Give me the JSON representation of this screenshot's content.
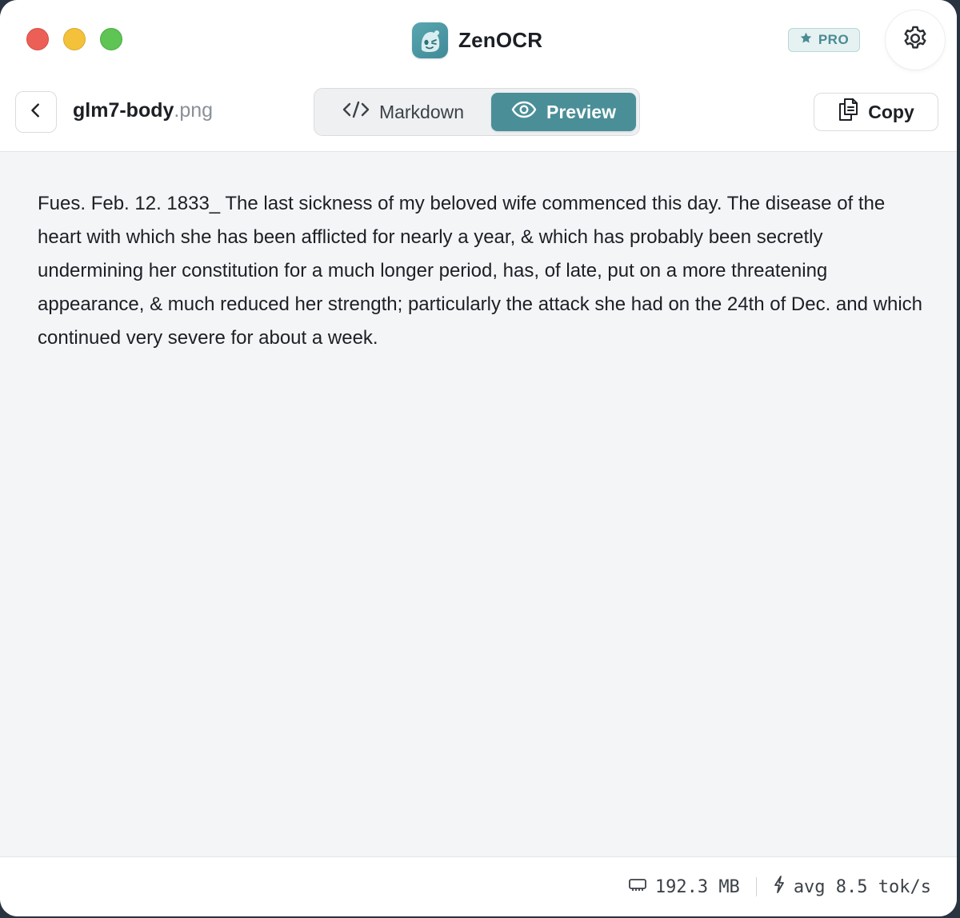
{
  "app": {
    "name": "ZenOCR",
    "badge": "PRO",
    "accent": "#4a8f98"
  },
  "toolbar": {
    "file_base": "glm7-body",
    "file_ext": ".png",
    "tabs": [
      {
        "label": "Markdown",
        "icon": "code-icon",
        "active": false
      },
      {
        "label": "Preview",
        "icon": "eye-icon",
        "active": true
      }
    ],
    "copy_label": "Copy"
  },
  "content": {
    "text": "Fues. Feb. 12. 1833_ The last sickness of my beloved wife commenced this day. The disease of the heart with which she has been afflicted for nearly a year, & which has probably been secretly undermining her constitution for a much longer period, has, of late, put on a more threatening appearance, & much reduced her strength; particularly the attack she had on the 24th of Dec. and which continued very severe for about a week."
  },
  "footer": {
    "memory": "192.3 MB",
    "speed": "avg 8.5 tok/s"
  }
}
